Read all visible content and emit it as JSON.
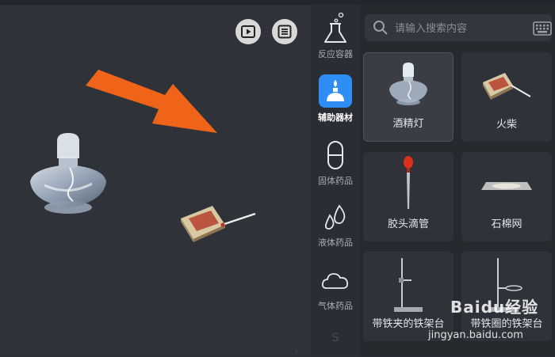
{
  "toolbar": {
    "play_icon": "play-icon",
    "list_icon": "list-icon"
  },
  "categories": [
    {
      "label": "反应容器",
      "icon": "flask-icon",
      "active": false
    },
    {
      "label": "辅助器材",
      "icon": "alcohol-lamp-icon",
      "active": true
    },
    {
      "label": "固体药品",
      "icon": "capsule-icon",
      "active": false
    },
    {
      "label": "液体药品",
      "icon": "droplets-icon",
      "active": false
    },
    {
      "label": "气体药品",
      "icon": "cloud-icon",
      "active": false
    }
  ],
  "search": {
    "placeholder": "请输入搜索内容"
  },
  "items": [
    {
      "label": "酒精灯",
      "icon": "alcohol-lamp-icon",
      "selected": true
    },
    {
      "label": "火柴",
      "icon": "matchbox-icon",
      "selected": false
    },
    {
      "label": "胶头滴管",
      "icon": "dropper-icon",
      "selected": false
    },
    {
      "label": "石棉网",
      "icon": "asbestos-gauze-icon",
      "selected": false
    },
    {
      "label": "带铁夹的铁架台",
      "icon": "iron-stand-clamp-icon",
      "selected": false
    },
    {
      "label": "带铁圈的铁架台",
      "icon": "iron-stand-ring-icon",
      "selected": false
    }
  ],
  "watermark": {
    "brand": "Baidu经验",
    "url": "jingyan.baidu.com"
  },
  "colors": {
    "accent": "#2e8ef4",
    "arrow": "#f0641a",
    "background": "#2c2f36"
  }
}
